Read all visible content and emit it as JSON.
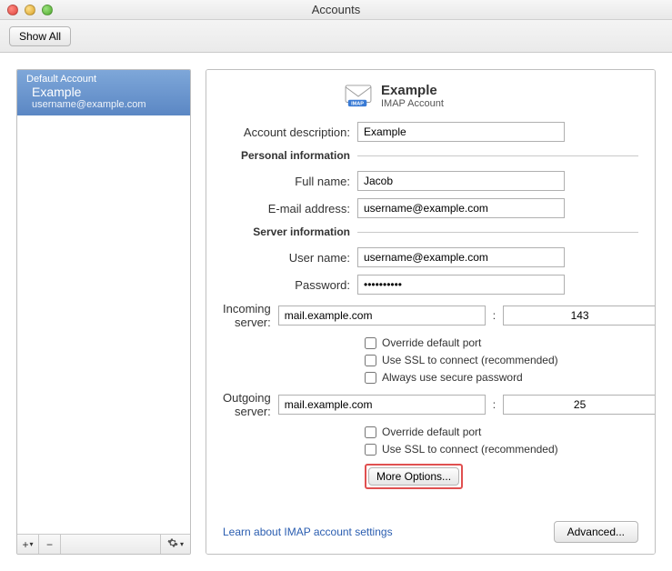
{
  "window": {
    "title": "Accounts"
  },
  "toolbar": {
    "showAll": "Show All"
  },
  "sidebar": {
    "account": {
      "defaultLabel": "Default Account",
      "name": "Example",
      "email": "username@example.com"
    },
    "footer": {
      "add": "+",
      "remove": "−",
      "addMenu": "▾",
      "gearMenu": "▾"
    }
  },
  "header": {
    "name": "Example",
    "type": "IMAP Account",
    "badge": "IMAP"
  },
  "labels": {
    "accountDescription": "Account description:",
    "personalInfo": "Personal information",
    "fullName": "Full name:",
    "emailAddress": "E-mail address:",
    "serverInfo": "Server information",
    "userName": "User name:",
    "password": "Password:",
    "incomingServer": "Incoming server:",
    "outgoingServer": "Outgoing server:",
    "overridePort": "Override default port",
    "useSSL": "Use SSL to connect (recommended)",
    "alwaysSecure": "Always use secure password",
    "moreOptions": "More Options...",
    "learnLink": "Learn about IMAP account settings",
    "advanced": "Advanced..."
  },
  "values": {
    "accountDescription": "Example",
    "fullName": "Jacob",
    "emailAddress": "username@example.com",
    "userName": "username@example.com",
    "password": "••••••••••",
    "incomingServer": "mail.example.com",
    "incomingPort": "143",
    "outgoingServer": "mail.example.com",
    "outgoingPort": "25"
  },
  "checkboxes": {
    "inOverride": false,
    "inSSL": false,
    "inSecure": false,
    "outOverride": false,
    "outSSL": false
  }
}
